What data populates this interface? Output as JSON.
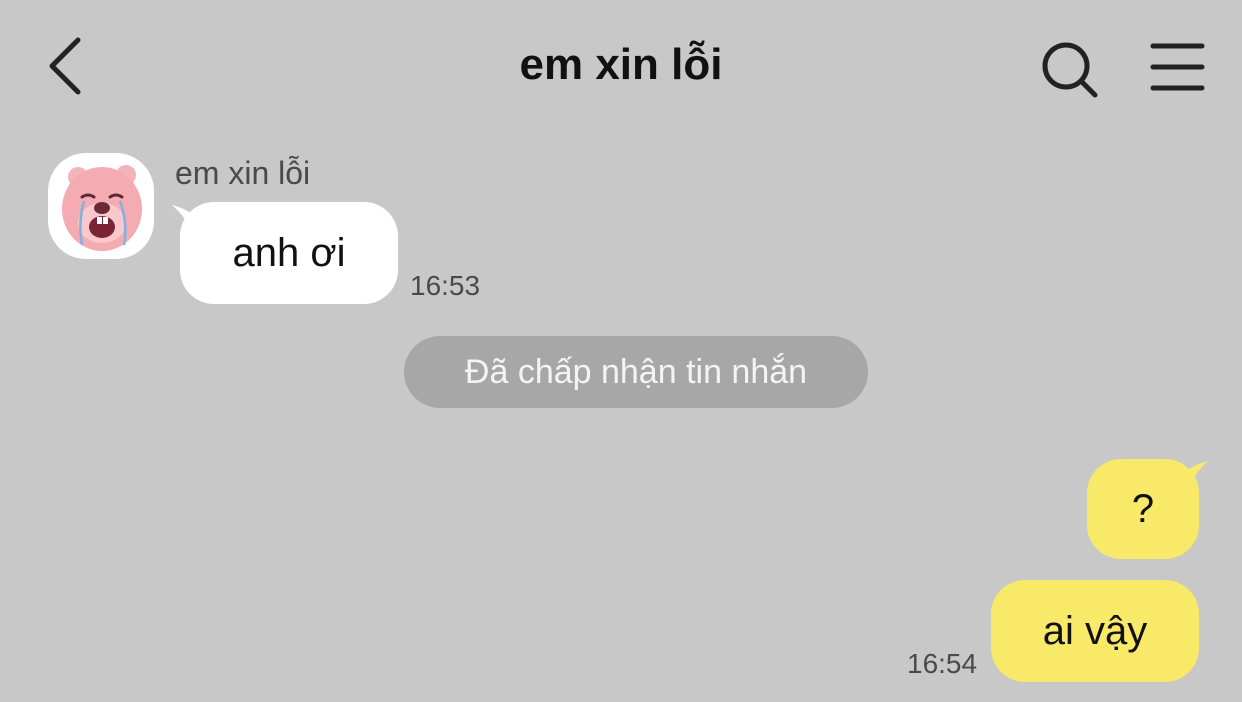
{
  "header": {
    "title": "em xin lỗi",
    "icons": {
      "back": "chevron-left-icon",
      "search": "search-icon",
      "menu": "hamburger-menu-icon"
    }
  },
  "messages": [
    {
      "direction": "incoming",
      "sender": "em xin lỗi",
      "text": "anh ơi",
      "time": "16:53"
    },
    {
      "direction": "outgoing",
      "text": "?"
    },
    {
      "direction": "outgoing",
      "text": "ai vậy",
      "time": "16:54"
    }
  ],
  "system_notice": "Đã chấp nhận tin nhắn",
  "colors": {
    "background": "#c8c8c8",
    "incoming_bubble": "#ffffff",
    "outgoing_bubble": "#f9e969",
    "system_pill": "#a7a7a7"
  },
  "avatar": {
    "icon": "crying-pink-beaver-avatar-icon"
  }
}
